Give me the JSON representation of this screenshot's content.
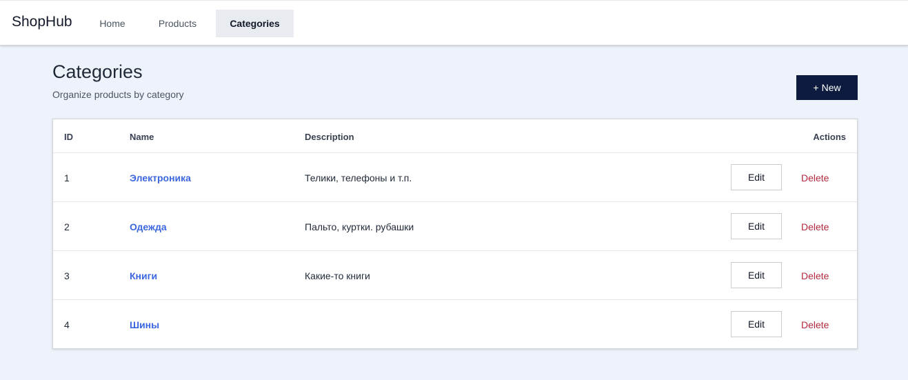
{
  "header": {
    "brand": "ShopHub",
    "nav": [
      {
        "label": "Home",
        "active": false
      },
      {
        "label": "Products",
        "active": false
      },
      {
        "label": "Categories",
        "active": true
      }
    ]
  },
  "page": {
    "title": "Categories",
    "subtitle": "Organize products by category",
    "new_button": {
      "icon": "+",
      "label": "New"
    }
  },
  "table": {
    "columns": [
      "ID",
      "Name",
      "Description",
      "Actions"
    ],
    "rows": [
      {
        "id": "1",
        "name": "Электроника",
        "description": "Телики, телефоны и т.п.",
        "edit": "Edit",
        "delete": "Delete"
      },
      {
        "id": "2",
        "name": "Одежда",
        "description": "Пальто, куртки. рубашки",
        "edit": "Edit",
        "delete": "Delete"
      },
      {
        "id": "3",
        "name": "Книги",
        "description": "Какие-то книги",
        "edit": "Edit",
        "delete": "Delete"
      },
      {
        "id": "4",
        "name": "Шины",
        "description": "",
        "edit": "Edit",
        "delete": "Delete"
      }
    ]
  },
  "colors": {
    "background": "#eef2fa",
    "primary_button": "#0d1b3e",
    "link": "#3b66e0",
    "danger": "#b3283e",
    "active_nav_bg": "#e8ecf0"
  }
}
